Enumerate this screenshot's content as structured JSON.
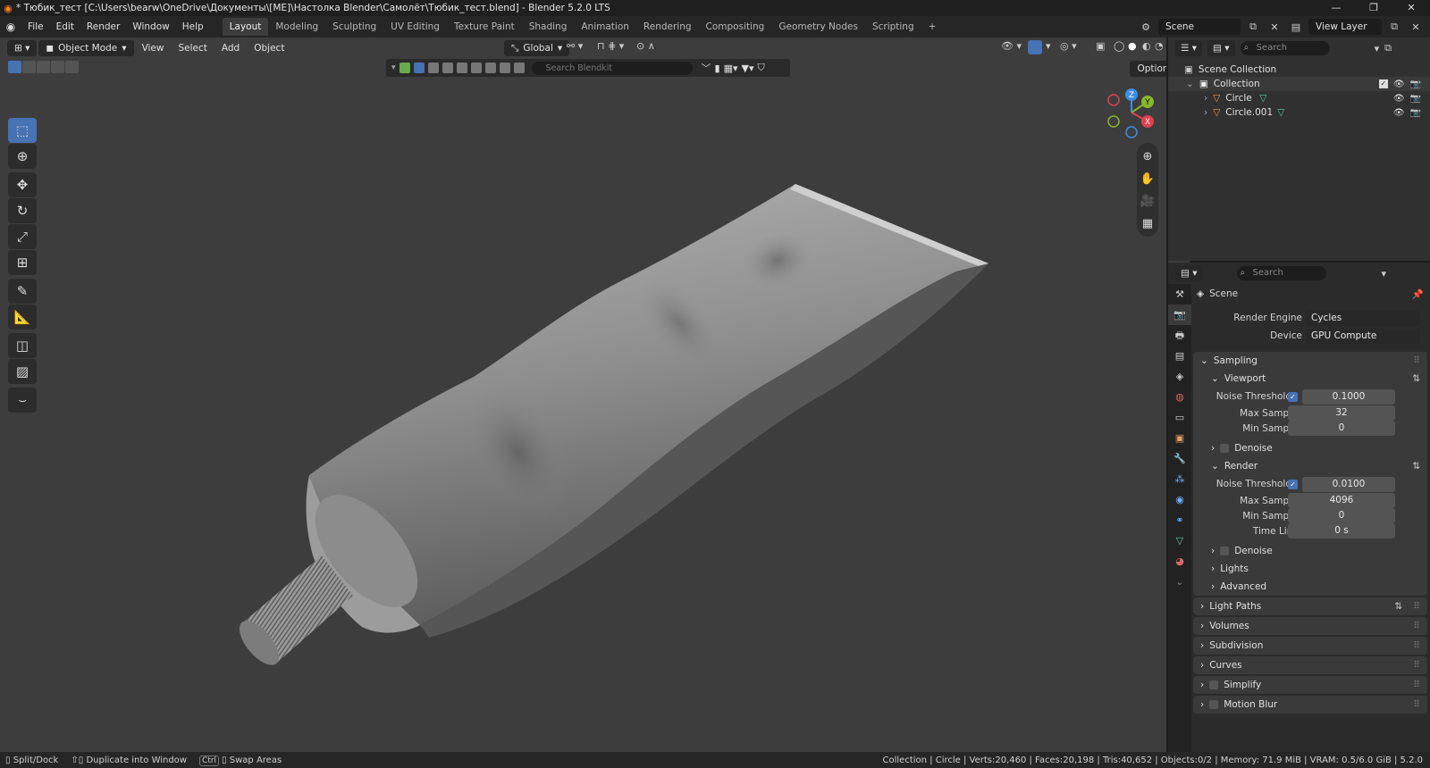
{
  "titlebar": {
    "title": "* Тюбик_тест [C:\\Users\\bearw\\OneDrive\\Документы\\[ME]\\Настолка Blender\\Самолёт\\Тюбик_тест.blend] - Blender 5.2.0 LTS",
    "min": "—",
    "max": "❐",
    "close": "✕"
  },
  "menu": {
    "items": [
      "File",
      "Edit",
      "Render",
      "Window",
      "Help"
    ],
    "workspaces": [
      "Layout",
      "Modeling",
      "Sculpting",
      "UV Editing",
      "Texture Paint",
      "Shading",
      "Animation",
      "Rendering",
      "Compositing",
      "Geometry Nodes",
      "Scripting"
    ],
    "active_workspace": "Layout",
    "add_tab": "+",
    "scene": "Scene",
    "view_layer": "View Layer"
  },
  "viewport": {
    "mode": "Object Mode",
    "menus": [
      "View",
      "Select",
      "Add",
      "Object"
    ],
    "transform_orientation": "Global",
    "search_placeholder": "Search Blendkit",
    "options": "Options",
    "gizmo": {
      "z": "Z",
      "y": "Y",
      "x": "X"
    }
  },
  "outliner": {
    "search_placeholder": "Search",
    "root": "Scene Collection",
    "collection": "Collection",
    "objects": [
      "Circle",
      "Circle.001"
    ]
  },
  "properties": {
    "search_placeholder": "Search",
    "context": "Scene",
    "render_engine_label": "Render Engine",
    "render_engine": "Cycles",
    "device_label": "Device",
    "device": "GPU Compute",
    "sampling": "Sampling",
    "viewport": {
      "title": "Viewport",
      "noise_threshold_label": "Noise Threshold",
      "noise_threshold": "0.1000",
      "max_samples_label": "Max Samples",
      "max_samples": "32",
      "min_samples_label": "Min Samples",
      "min_samples": "0",
      "denoise": "Denoise"
    },
    "render": {
      "title": "Render",
      "noise_threshold_label": "Noise Threshold",
      "noise_threshold": "0.0100",
      "max_samples_label": "Max Samples",
      "max_samples": "4096",
      "min_samples_label": "Min Samples",
      "min_samples": "0",
      "time_limit_label": "Time Limit",
      "time_limit": "0 s",
      "denoise": "Denoise"
    },
    "lights": "Lights",
    "advanced": "Advanced",
    "panels": [
      "Light Paths",
      "Volumes",
      "Subdivision",
      "Curves",
      "Simplify",
      "Motion Blur"
    ]
  },
  "statusbar": {
    "split_dock": "Split/Dock",
    "duplicate": "Duplicate into Window",
    "ctrl": "Ctrl",
    "swap": "Swap Areas",
    "info": "Collection | Circle | Verts:20,460 | Faces:20,198 | Tris:40,652 | Objects:0/2 | Memory: 71.9 MiB | VRAM: 0.5/6.0 GiB | 5.2.0"
  },
  "colors": {
    "accent": "#4772b3",
    "viewport_bg": "#3d3d3d",
    "blender_orange": "#ff7f1f",
    "axis_x": "#e0414f",
    "axis_y": "#87b829",
    "axis_z": "#3d8ee6"
  }
}
